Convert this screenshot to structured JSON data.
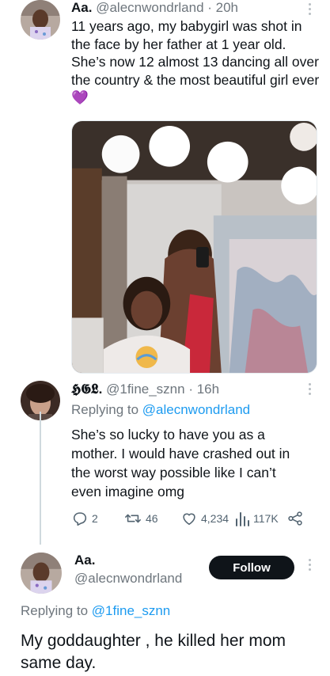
{
  "tweet1": {
    "name": "Aa.",
    "handle_time": "@alecnwondrland · 20h",
    "body": "11 years ago, my babygirl was shot in the face by her father at 1 year old. She’s now 12 almost 13 dancing all over the country & the most beautiful girl ever ",
    "emoji": "💜"
  },
  "tweet2": {
    "name": "𝕳𝕲𝕷.",
    "handle_time": "@1fine_sznn · 16h",
    "replying_prefix": "Replying to ",
    "replying_to": "@alecnwondrland",
    "body": "She’s so lucky to have you as a mother. I would have crashed out in the worst way possible like I can’t even imagine omg",
    "replies": "2",
    "retweets": "46",
    "likes": "4,234",
    "views": "117K"
  },
  "tweet3": {
    "name": "Aa.",
    "handle": "@alecnwondrland",
    "follow_label": "Follow",
    "replying_prefix": "Replying to ",
    "replying_to": "@1fine_sznn",
    "body": "My goddaughter , he killed her mom same day."
  },
  "icons": {
    "reply": "reply-icon",
    "retweet": "retweet-icon",
    "like": "heart-icon",
    "views": "views-icon",
    "share": "share-icon",
    "more": "more-icon"
  },
  "colors": {
    "link": "#1d9bf0",
    "secondary_text": "#6e767d",
    "follow_bg": "#0f1419"
  }
}
